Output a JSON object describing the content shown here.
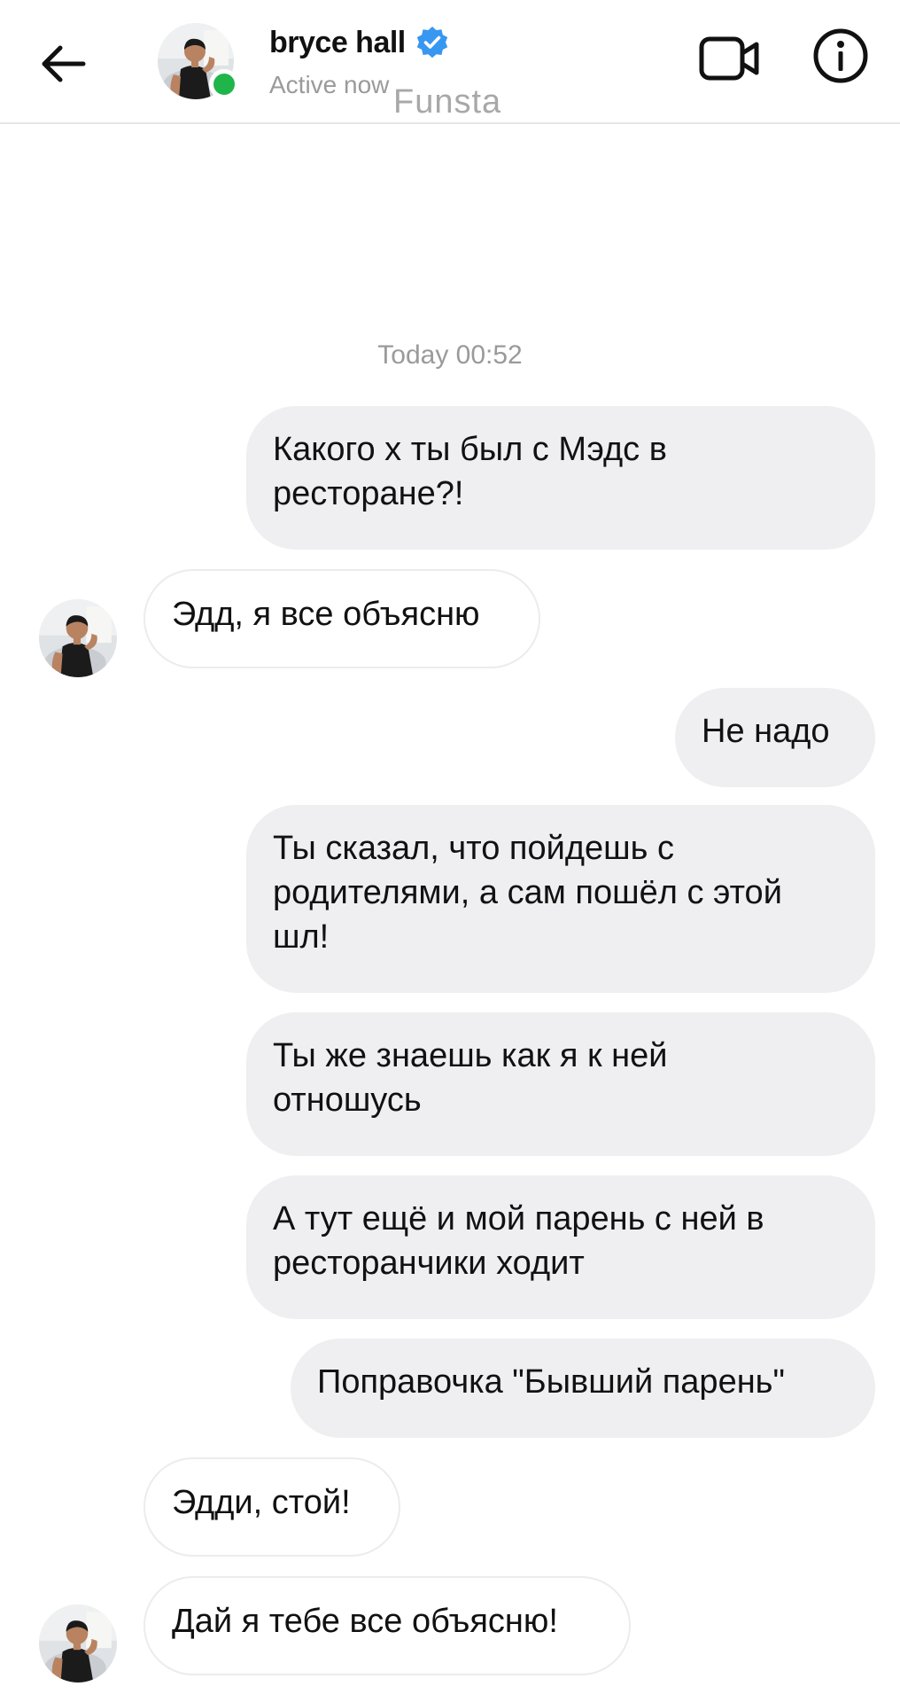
{
  "header": {
    "contact_name": "bryce hall",
    "status": "Active now",
    "watermark": "Funsta"
  },
  "icons": {
    "back": "arrow-left-icon",
    "verified": "verified-badge-icon",
    "video": "video-camera-icon",
    "info": "info-icon"
  },
  "colors": {
    "online": "#1fb54a",
    "verified": "#3897f0",
    "outgoing_bubble": "#efeef0",
    "incoming_bubble_border": "#ececec",
    "muted_text": "#9a9a9a"
  },
  "chat": {
    "timestamp": "Today 00:52",
    "messages": [
      {
        "dir": "out",
        "lines": [
          "Какого х ты был с Мэдс в",
          "ресторане?!"
        ]
      },
      {
        "dir": "in",
        "lines": [
          "Эдд, я все объясню"
        ]
      },
      {
        "dir": "out",
        "lines": [
          "Не надо"
        ]
      },
      {
        "dir": "out",
        "lines": [
          "Ты сказал, что пойдешь с",
          "родителями, а сам пошёл с этой",
          "шл!"
        ]
      },
      {
        "dir": "out",
        "lines": [
          "Ты же знаешь как я к ней",
          "отношусь"
        ]
      },
      {
        "dir": "out",
        "lines": [
          "А тут ещё и мой парень с ней в",
          "ресторанчики ходит"
        ]
      },
      {
        "dir": "out",
        "lines": [
          "Поправочка \"Бывший парень\""
        ]
      },
      {
        "dir": "in",
        "lines": [
          "Эдди, стой!"
        ]
      },
      {
        "dir": "in",
        "lines": [
          "Дай я тебе все объясню!"
        ]
      }
    ]
  }
}
